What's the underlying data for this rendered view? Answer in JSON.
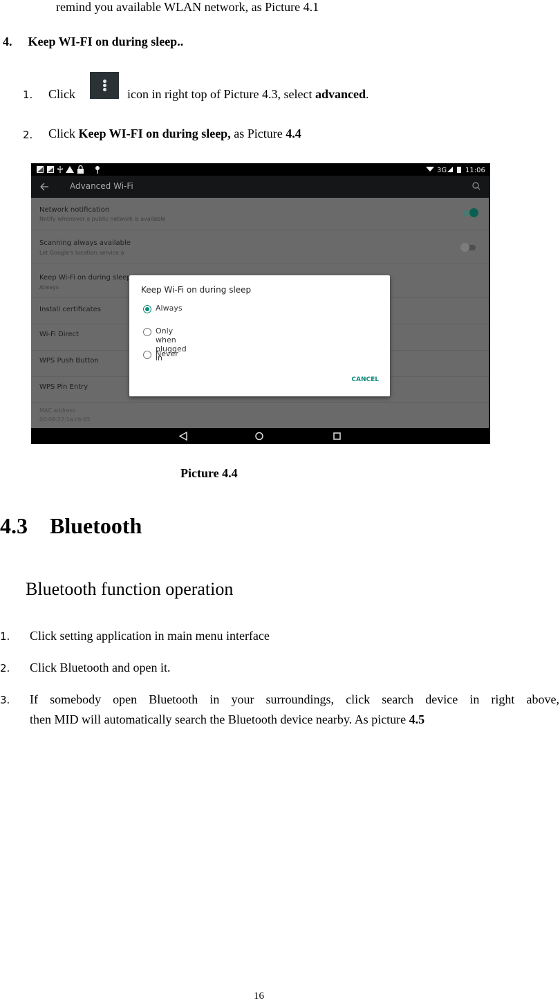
{
  "intro_line": "remind you available WLAN network, as Picture 4.1",
  "section4": {
    "number": "4.",
    "title": "Keep WI-FI on during sleep..",
    "steps": [
      {
        "num": "1.",
        "pre": "Click",
        "icon": "overflow-menu-icon",
        "post": "icon in right top of Picture 4.3, select ",
        "bold": "advanced",
        "tail": "."
      },
      {
        "num": "2.",
        "pre": "Click ",
        "bold": "Keep WI-FI on during sleep,",
        "post": " as Picture ",
        "bold2": "4.4"
      }
    ]
  },
  "screenshot": {
    "status_left_icons": [
      "screenshot-icon",
      "screenshot-icon",
      "usb-icon",
      "warning-icon",
      "lock-icon",
      "pin-icon"
    ],
    "status_right": {
      "network": "3G",
      "time": "11:06"
    },
    "appbar_title": "Advanced Wi-Fi",
    "list": [
      {
        "title": "Network notification",
        "subtitle": "Notify whenever a public network is available",
        "toggle": true
      },
      {
        "title": "Scanning always available",
        "subtitle": "Let Google's location service a",
        "toggle": false
      },
      {
        "title": "Keep Wi-Fi on during sleep",
        "subtitle": "Always"
      },
      {
        "title": "Install certificates"
      },
      {
        "title": "Wi-Fi Direct"
      },
      {
        "title": "WPS Push Button"
      },
      {
        "title": "WPS Pin Entry"
      },
      {
        "title": "MAC address",
        "subtitle": "00:08:22:1a:cb:65"
      }
    ],
    "dialog": {
      "title": "Keep Wi-Fi on during sleep",
      "options": [
        "Always",
        "Only when plugged in",
        "Never"
      ],
      "selected": "Always",
      "cancel_label": "CANCEL"
    },
    "accent_color": "#0e8a7a"
  },
  "caption": "Picture 4.4",
  "section43": {
    "number": "4.3",
    "title": "Bluetooth",
    "subtitle": "Bluetooth function operation",
    "steps": [
      {
        "num": "1.",
        "text": "Click setting application in main menu interface"
      },
      {
        "num": "2.",
        "text": "Click Bluetooth and open it."
      },
      {
        "num": "3.",
        "line1": "If somebody open Bluetooth in your surroundings, click search device in right above,",
        "line2": "then MID will automatically search the Bluetooth device nearby. As picture ",
        "bold": "4.5"
      }
    ]
  },
  "page_number": "16"
}
